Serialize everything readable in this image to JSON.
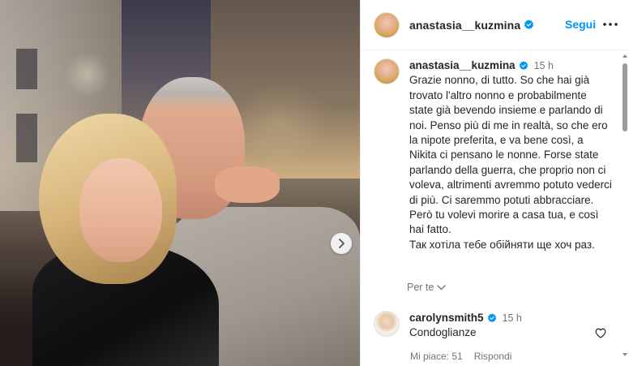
{
  "post": {
    "image_alt": "Foto: abbraccio con il nonno in una strada di notte",
    "next_icon": "chevron-right-icon"
  },
  "header": {
    "username": "anastasia__kuzmina",
    "follow_label": "Segui",
    "more_icon": "more-horizontal-icon",
    "verified_color": "#0095f6"
  },
  "caption": {
    "username": "anastasia__kuzmina",
    "time": "15 h",
    "paragraphs": [
      "Grazie nonno, di tutto. So che hai già trovato l'altro nonno e probabilmente state già bevendo insieme e parlando di noi. Penso più di me in realtà, so che ero la nipote preferita, e va bene così, a Nikita ci pensano le nonne. Forse state parlando della guerra, che proprio non ci voleva, altrimenti avremmo potuto vederci di più. Ci saremmo potuti abbracciare.",
      "Però tu volevi morire a casa tua, e così hai fatto.",
      "Так хотіла тебе обійняти ще хоч раз."
    ],
    "translate_label": "Per te"
  },
  "comments": [
    {
      "username": "carolynsmith5",
      "time": "15 h",
      "text": "Condoglianze",
      "likes_label": "Mi piace: 51",
      "reply_label": "Rispondi"
    }
  ],
  "colors": {
    "accent": "#0095f6",
    "text": "#262626",
    "muted": "#737373"
  }
}
